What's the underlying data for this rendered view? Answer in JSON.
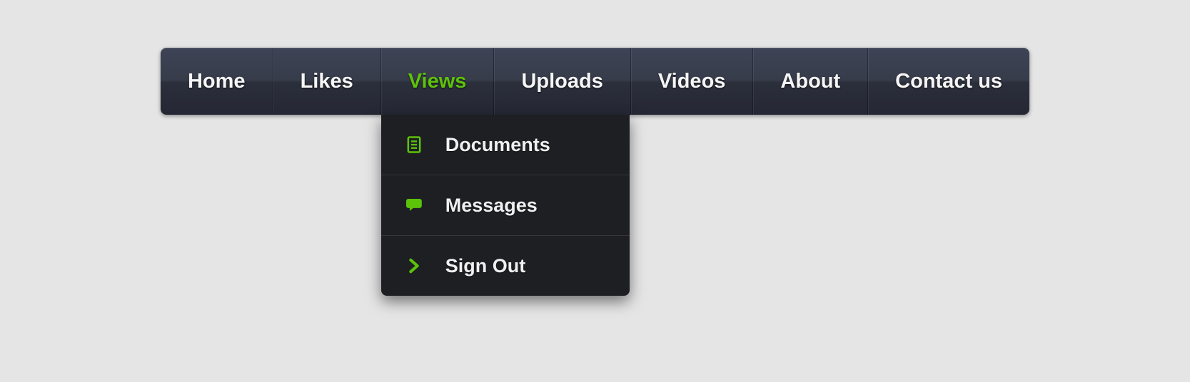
{
  "nav": {
    "items": [
      {
        "label": "Home"
      },
      {
        "label": "Likes"
      },
      {
        "label": "Views"
      },
      {
        "label": "Uploads"
      },
      {
        "label": "Videos"
      },
      {
        "label": "About"
      },
      {
        "label": "Contact us"
      }
    ]
  },
  "dropdown": {
    "items": [
      {
        "label": "Documents"
      },
      {
        "label": "Messages"
      },
      {
        "label": "Sign Out"
      }
    ]
  },
  "colors": {
    "accent": "#5dc20a"
  }
}
